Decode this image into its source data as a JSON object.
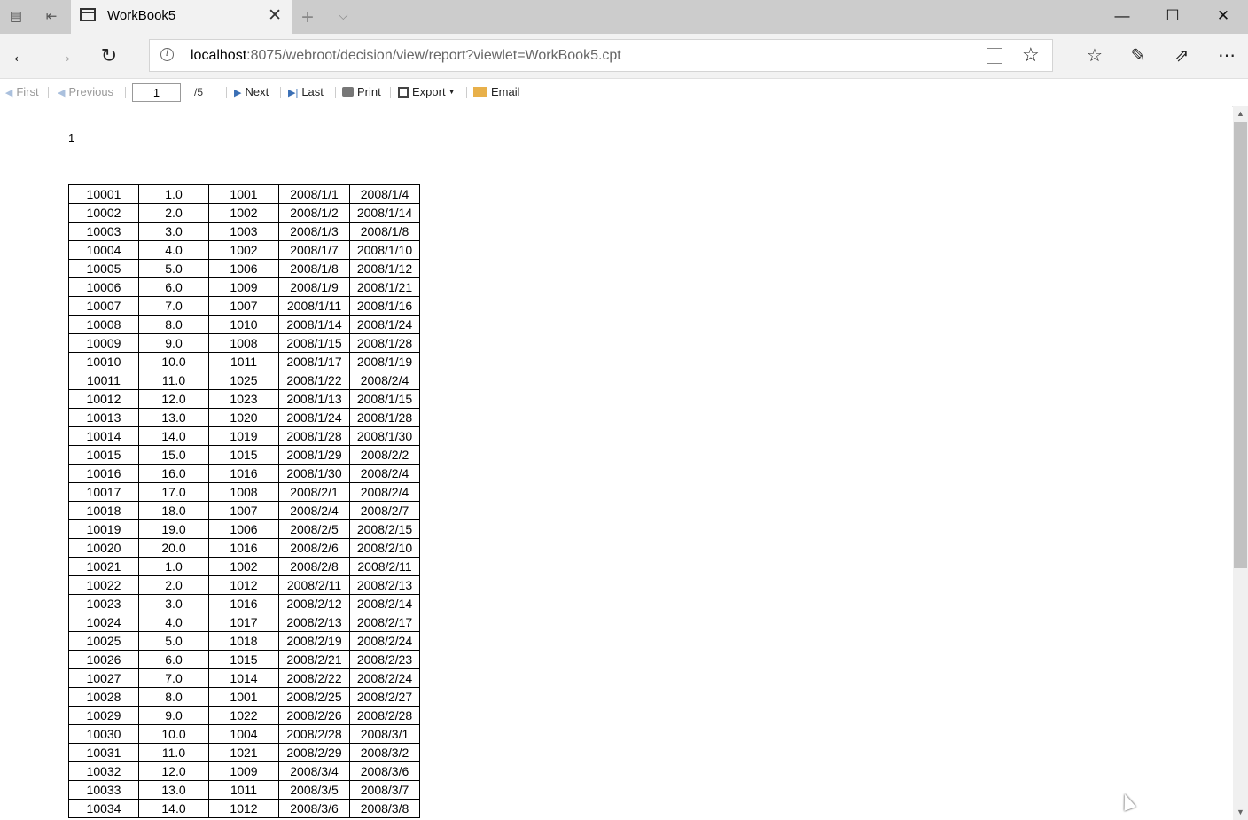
{
  "window": {
    "tab_title": "WorkBook5",
    "tab_close": "✕",
    "new_tab": "+",
    "tab_menu": "⌵",
    "minimize": "—",
    "maximize": "☐",
    "close": "✕"
  },
  "address_bar": {
    "url_host": "localhost",
    "url_rest": ":8075/webroot/decision/view/report?viewlet=WorkBook5.cpt"
  },
  "toolbar": {
    "first_label": "First",
    "previous_label": "Previous",
    "page_value": "1",
    "page_total": "/5",
    "next_label": "Next",
    "last_label": "Last",
    "print_label": "Print",
    "export_label": "Export",
    "email_label": "Email"
  },
  "report": {
    "page_number": "1",
    "rows": [
      [
        "10001",
        "1.0",
        "1001",
        "2008/1/1",
        "2008/1/4"
      ],
      [
        "10002",
        "2.0",
        "1002",
        "2008/1/2",
        "2008/1/14"
      ],
      [
        "10003",
        "3.0",
        "1003",
        "2008/1/3",
        "2008/1/8"
      ],
      [
        "10004",
        "4.0",
        "1002",
        "2008/1/7",
        "2008/1/10"
      ],
      [
        "10005",
        "5.0",
        "1006",
        "2008/1/8",
        "2008/1/12"
      ],
      [
        "10006",
        "6.0",
        "1009",
        "2008/1/9",
        "2008/1/21"
      ],
      [
        "10007",
        "7.0",
        "1007",
        "2008/1/11",
        "2008/1/16"
      ],
      [
        "10008",
        "8.0",
        "1010",
        "2008/1/14",
        "2008/1/24"
      ],
      [
        "10009",
        "9.0",
        "1008",
        "2008/1/15",
        "2008/1/28"
      ],
      [
        "10010",
        "10.0",
        "1011",
        "2008/1/17",
        "2008/1/19"
      ],
      [
        "10011",
        "11.0",
        "1025",
        "2008/1/22",
        "2008/2/4"
      ],
      [
        "10012",
        "12.0",
        "1023",
        "2008/1/13",
        "2008/1/15"
      ],
      [
        "10013",
        "13.0",
        "1020",
        "2008/1/24",
        "2008/1/28"
      ],
      [
        "10014",
        "14.0",
        "1019",
        "2008/1/28",
        "2008/1/30"
      ],
      [
        "10015",
        "15.0",
        "1015",
        "2008/1/29",
        "2008/2/2"
      ],
      [
        "10016",
        "16.0",
        "1016",
        "2008/1/30",
        "2008/2/4"
      ],
      [
        "10017",
        "17.0",
        "1008",
        "2008/2/1",
        "2008/2/4"
      ],
      [
        "10018",
        "18.0",
        "1007",
        "2008/2/4",
        "2008/2/7"
      ],
      [
        "10019",
        "19.0",
        "1006",
        "2008/2/5",
        "2008/2/15"
      ],
      [
        "10020",
        "20.0",
        "1016",
        "2008/2/6",
        "2008/2/10"
      ],
      [
        "10021",
        "1.0",
        "1002",
        "2008/2/8",
        "2008/2/11"
      ],
      [
        "10022",
        "2.0",
        "1012",
        "2008/2/11",
        "2008/2/13"
      ],
      [
        "10023",
        "3.0",
        "1016",
        "2008/2/12",
        "2008/2/14"
      ],
      [
        "10024",
        "4.0",
        "1017",
        "2008/2/13",
        "2008/2/17"
      ],
      [
        "10025",
        "5.0",
        "1018",
        "2008/2/19",
        "2008/2/24"
      ],
      [
        "10026",
        "6.0",
        "1015",
        "2008/2/21",
        "2008/2/23"
      ],
      [
        "10027",
        "7.0",
        "1014",
        "2008/2/22",
        "2008/2/24"
      ],
      [
        "10028",
        "8.0",
        "1001",
        "2008/2/25",
        "2008/2/27"
      ],
      [
        "10029",
        "9.0",
        "1022",
        "2008/2/26",
        "2008/2/28"
      ],
      [
        "10030",
        "10.0",
        "1004",
        "2008/2/28",
        "2008/3/1"
      ],
      [
        "10031",
        "11.0",
        "1021",
        "2008/2/29",
        "2008/3/2"
      ],
      [
        "10032",
        "12.0",
        "1009",
        "2008/3/4",
        "2008/3/6"
      ],
      [
        "10033",
        "13.0",
        "1011",
        "2008/3/5",
        "2008/3/7"
      ],
      [
        "10034",
        "14.0",
        "1012",
        "2008/3/6",
        "2008/3/8"
      ]
    ]
  }
}
